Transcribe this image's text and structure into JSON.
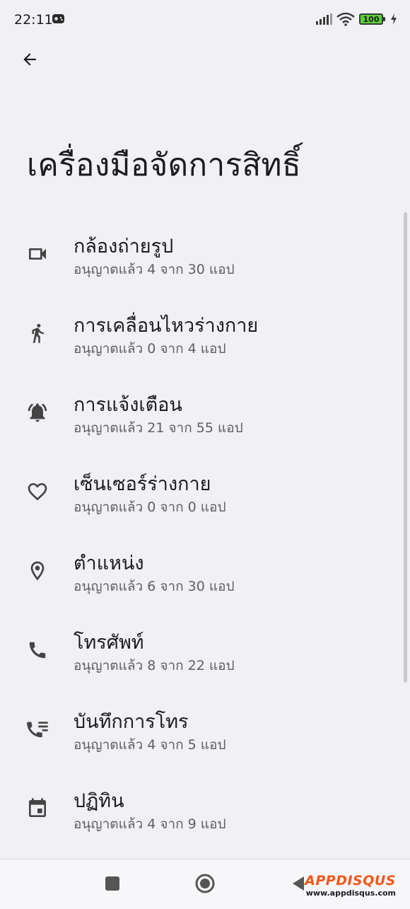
{
  "status": {
    "time": "22:11",
    "battery": "100"
  },
  "page": {
    "title": "เครื่องมือจัดการสิทธิ์"
  },
  "permissions": [
    {
      "title": "กล้องถ่ายรูป",
      "subtitle": "อนุญาตแล้ว 4 จาก 30 แอป",
      "icon": "camera-icon"
    },
    {
      "title": "การเคลื่อนไหวร่างกาย",
      "subtitle": "อนุญาตแล้ว 0 จาก 4 แอป",
      "icon": "walking-icon"
    },
    {
      "title": "การแจ้งเตือน",
      "subtitle": "อนุญาตแล้ว 21 จาก 55 แอป",
      "icon": "bell-icon"
    },
    {
      "title": "เซ็นเซอร์ร่างกาย",
      "subtitle": "อนุญาตแล้ว 0 จาก 0 แอป",
      "icon": "heart-icon"
    },
    {
      "title": "ตำแหน่ง",
      "subtitle": "อนุญาตแล้ว 6 จาก 30 แอป",
      "icon": "location-icon"
    },
    {
      "title": "โทรศัพท์",
      "subtitle": "อนุญาตแล้ว 8 จาก 22 แอป",
      "icon": "phone-icon"
    },
    {
      "title": "บันทึกการโทร",
      "subtitle": "อนุญาตแล้ว 4 จาก 5 แอป",
      "icon": "call-log-icon"
    },
    {
      "title": "ปฏิทิน",
      "subtitle": "อนุญาตแล้ว 4 จาก 9 แอป",
      "icon": "calendar-icon"
    }
  ],
  "watermark": {
    "logo": "APPDISQUS",
    "url": "www.appdisqus.com"
  }
}
